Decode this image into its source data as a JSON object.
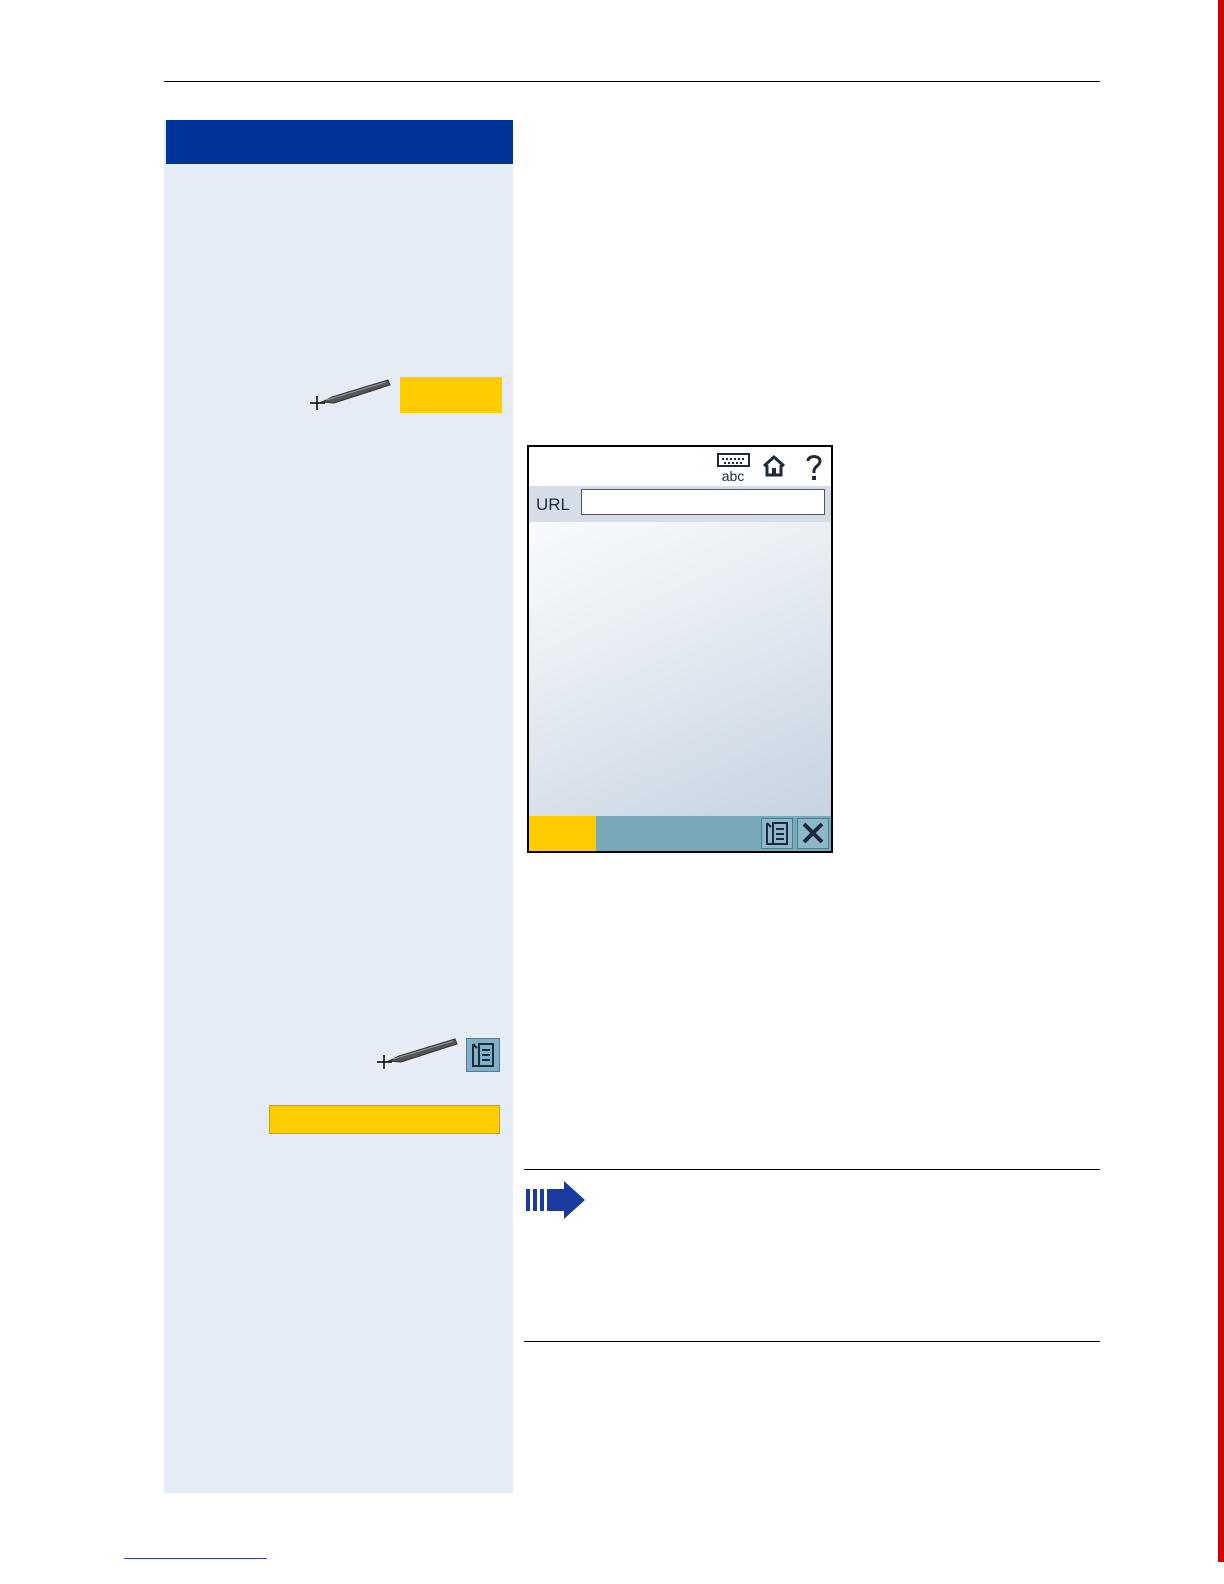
{
  "page": {
    "header_rule": "",
    "left_column_heading": ""
  },
  "phone_screen": {
    "url_label": "URL",
    "url_value": "",
    "toolbar_icons": [
      "keyboard-abc-icon",
      "home-icon",
      "help-icon"
    ],
    "softkey_icons": [
      "menu-icon",
      "close-icon"
    ]
  },
  "colors": {
    "heading_blue": "#003399",
    "column_bg": "#e6ecf5",
    "key_yellow": "#ffcc00",
    "bar_teal": "#7aa8bb",
    "note_arrow": "#1a3aa0",
    "page_edge_red": "#d00000"
  },
  "icons": {
    "stylus": "stylus-icon",
    "menu": "menu-icon",
    "note": "note-arrow-icon"
  }
}
